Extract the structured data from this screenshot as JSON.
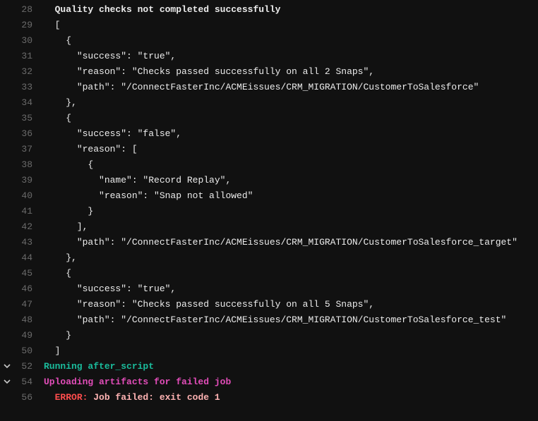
{
  "lines": [
    {
      "num": "28",
      "fold": "",
      "indent": "  ",
      "cls": "c-white",
      "text": "Quality checks not completed successfully"
    },
    {
      "num": "29",
      "fold": "",
      "indent": "  ",
      "cls": "c-plain",
      "text": "["
    },
    {
      "num": "30",
      "fold": "",
      "indent": "    ",
      "cls": "c-plain",
      "text": "{"
    },
    {
      "num": "31",
      "fold": "",
      "indent": "      ",
      "cls": "c-plain",
      "text": "\"success\": \"true\","
    },
    {
      "num": "32",
      "fold": "",
      "indent": "      ",
      "cls": "c-plain",
      "text": "\"reason\": \"Checks passed successfully on all 2 Snaps\","
    },
    {
      "num": "33",
      "fold": "",
      "indent": "      ",
      "cls": "c-plain",
      "text": "\"path\": \"/ConnectFasterInc/ACMEissues/CRM_MIGRATION/CustomerToSalesforce\""
    },
    {
      "num": "34",
      "fold": "",
      "indent": "    ",
      "cls": "c-plain",
      "text": "},"
    },
    {
      "num": "35",
      "fold": "",
      "indent": "    ",
      "cls": "c-plain",
      "text": "{"
    },
    {
      "num": "36",
      "fold": "",
      "indent": "      ",
      "cls": "c-plain",
      "text": "\"success\": \"false\","
    },
    {
      "num": "37",
      "fold": "",
      "indent": "      ",
      "cls": "c-plain",
      "text": "\"reason\": ["
    },
    {
      "num": "38",
      "fold": "",
      "indent": "        ",
      "cls": "c-plain",
      "text": "{"
    },
    {
      "num": "39",
      "fold": "",
      "indent": "          ",
      "cls": "c-plain",
      "text": "\"name\": \"Record Replay\","
    },
    {
      "num": "40",
      "fold": "",
      "indent": "          ",
      "cls": "c-plain",
      "text": "\"reason\": \"Snap not allowed\""
    },
    {
      "num": "41",
      "fold": "",
      "indent": "        ",
      "cls": "c-plain",
      "text": "}"
    },
    {
      "num": "42",
      "fold": "",
      "indent": "      ",
      "cls": "c-plain",
      "text": "],"
    },
    {
      "num": "43",
      "fold": "",
      "indent": "      ",
      "cls": "c-plain",
      "text": "\"path\": \"/ConnectFasterInc/ACMEissues/CRM_MIGRATION/CustomerToSalesforce_target\""
    },
    {
      "num": "44",
      "fold": "",
      "indent": "    ",
      "cls": "c-plain",
      "text": "},"
    },
    {
      "num": "45",
      "fold": "",
      "indent": "    ",
      "cls": "c-plain",
      "text": "{"
    },
    {
      "num": "46",
      "fold": "",
      "indent": "      ",
      "cls": "c-plain",
      "text": "\"success\": \"true\","
    },
    {
      "num": "47",
      "fold": "",
      "indent": "      ",
      "cls": "c-plain",
      "text": "\"reason\": \"Checks passed successfully on all 5 Snaps\","
    },
    {
      "num": "48",
      "fold": "",
      "indent": "      ",
      "cls": "c-plain",
      "text": "\"path\": \"/ConnectFasterInc/ACMEissues/CRM_MIGRATION/CustomerToSalesforce_test\""
    },
    {
      "num": "49",
      "fold": "",
      "indent": "    ",
      "cls": "c-plain",
      "text": "}"
    },
    {
      "num": "50",
      "fold": "",
      "indent": "  ",
      "cls": "c-plain",
      "text": "]"
    },
    {
      "num": "52",
      "fold": "v",
      "indent": "",
      "cls": "c-teal",
      "text": "Running after_script"
    },
    {
      "num": "54",
      "fold": "v",
      "indent": "",
      "cls": "c-magenta",
      "text": "Uploading artifacts for failed job"
    },
    {
      "num": "56",
      "fold": "",
      "indent": "  ",
      "cls": "error",
      "label": "ERROR: ",
      "msg": "Job failed: exit code 1"
    }
  ]
}
